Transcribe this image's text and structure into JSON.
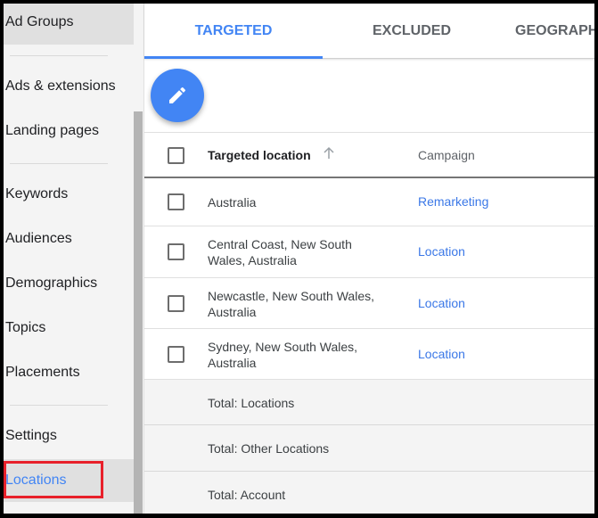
{
  "sidebar": {
    "items": [
      {
        "label": "Ad Groups",
        "state": "hover"
      },
      {
        "label": "Ads & extensions"
      },
      {
        "label": "Landing pages"
      },
      {
        "label": "Keywords"
      },
      {
        "label": "Audiences"
      },
      {
        "label": "Demographics"
      },
      {
        "label": "Topics"
      },
      {
        "label": "Placements"
      },
      {
        "label": "Settings"
      },
      {
        "label": "Locations",
        "state": "active"
      }
    ]
  },
  "tabs": [
    {
      "label": "TARGETED",
      "active": true
    },
    {
      "label": "EXCLUDED",
      "active": false
    },
    {
      "label": "GEOGRAPHIC",
      "active": false
    }
  ],
  "fab": {
    "icon": "pencil-icon",
    "label": "Edit"
  },
  "table": {
    "columns": {
      "location": "Targeted location",
      "campaign": "Campaign",
      "sort_direction": "ascending"
    },
    "rows": [
      {
        "location": "Australia",
        "campaign": "Remarketing"
      },
      {
        "location": "Central Coast, New South Wales, Australia",
        "campaign": "Location"
      },
      {
        "location": "Newcastle, New South Wales, Australia",
        "campaign": "Location"
      },
      {
        "location": "Sydney, New South Wales, Australia",
        "campaign": "Location"
      }
    ],
    "totals": [
      "Total: Locations",
      "Total: Other Locations",
      "Total: Account"
    ]
  },
  "colors": {
    "accent": "#4285f4",
    "link": "#3b78e7",
    "highlight_box": "#e8202a"
  }
}
